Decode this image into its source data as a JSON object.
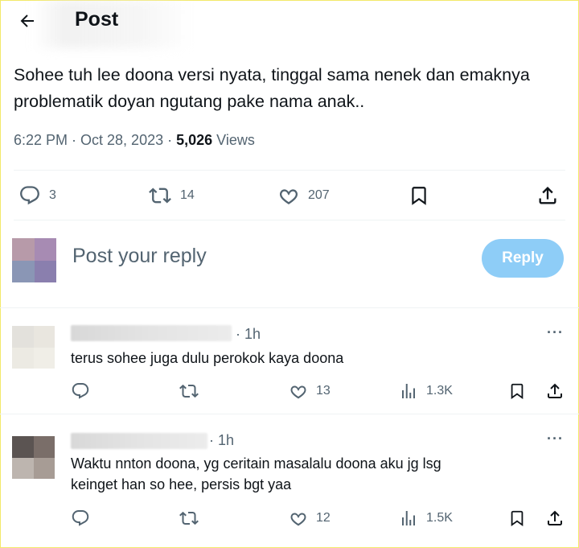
{
  "header": {
    "title": "Post"
  },
  "post": {
    "text": "Sohee tuh lee doona versi nyata, tinggal sama nenek dan emaknya problematik doyan ngutang pake nama anak..",
    "time_date": "6:22 PM · Oct 28, 2023 · ",
    "views_count": "5,026",
    "views_label": " Views",
    "replies": "3",
    "reposts": "14",
    "likes": "207"
  },
  "reply_box": {
    "placeholder": "Post your reply",
    "button": "Reply"
  },
  "comments": [
    {
      "time": "· 1h",
      "text": "terus sohee juga dulu perokok kaya doona",
      "likes": "13",
      "views": "1.3K"
    },
    {
      "time": "· 1h",
      "text_line1": "Waktu nnton doona, yg ceritain masalalu doona aku jg lsg",
      "text_line2": "keinget han so hee, persis bgt yaa",
      "likes": "12",
      "views": "1.5K"
    }
  ],
  "colors": {
    "accent": "#1d9bf0",
    "reply_button": "#8ecdf7",
    "muted": "#536471",
    "text": "#0f1419"
  },
  "icons": [
    "back-arrow-icon",
    "reply-icon",
    "repost-icon",
    "like-icon",
    "bookmark-icon",
    "share-icon",
    "views-icon",
    "more-icon"
  ]
}
